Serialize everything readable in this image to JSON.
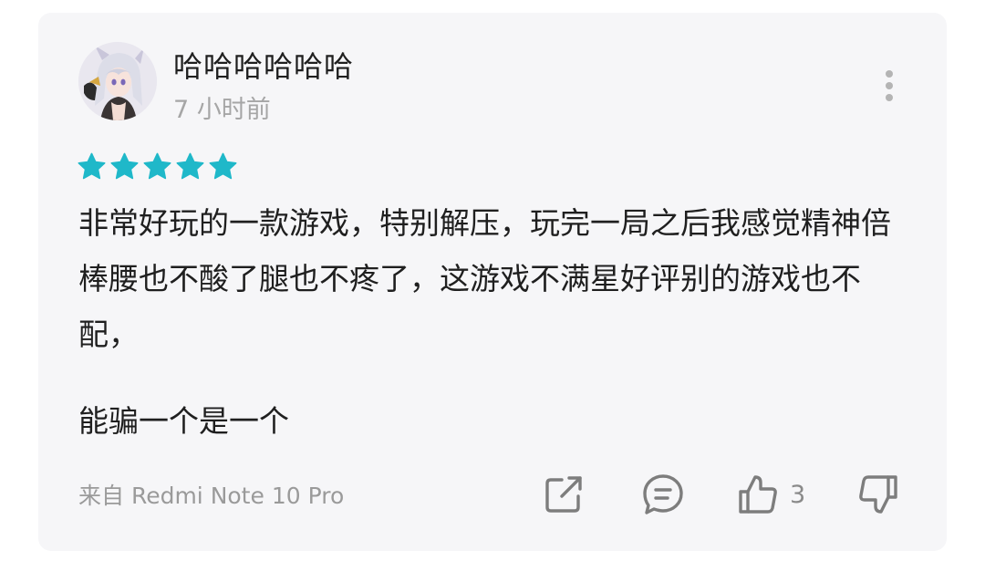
{
  "review": {
    "user": {
      "name": "哈哈哈哈哈哈",
      "time": "7 小时前",
      "avatar_icon": "anime-character-avatar"
    },
    "rating": 5,
    "rating_color": "#1fb8c9",
    "paragraphs": [
      "非常好玩的一款游戏，特别解压，玩完一局之后我感觉精神倍棒腰也不酸了腿也不疼了，这游戏不满星好评别的游戏也不配，",
      "能骗一个是一个"
    ],
    "device": "来自 Redmi Note 10 Pro",
    "actions": {
      "like_count": "3",
      "icons": [
        "share-icon",
        "comment-icon",
        "thumbs-up-icon",
        "thumbs-down-icon",
        "more-vertical-icon"
      ]
    }
  }
}
